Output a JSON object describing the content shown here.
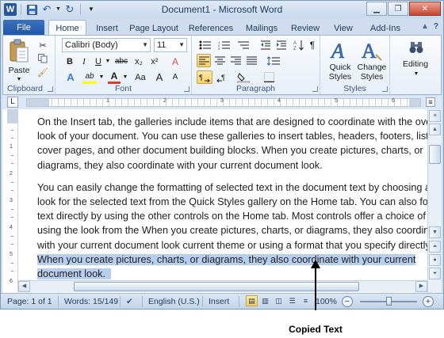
{
  "window": {
    "title": "Document1  -  Microsoft Word"
  },
  "ribbon_tabs": {
    "file": "File",
    "home": "Home",
    "insert": "Insert",
    "page_layout": "Page Layout",
    "references": "References",
    "mailings": "Mailings",
    "review": "Review",
    "view": "View",
    "addins": "Add-Ins"
  },
  "clipboard": {
    "paste_label": "Paste",
    "group_label": "Clipboard"
  },
  "font": {
    "font_name": "Calibri (Body)",
    "font_size": "11",
    "group_label": "Font",
    "bold": "B",
    "italic": "I",
    "underline": "U",
    "strike": "abc",
    "subscript": "x₂",
    "superscript": "x²",
    "text_effects": "A",
    "highlight": "ab",
    "font_color": "A",
    "change_case": "Aa",
    "grow": "A",
    "shrink": "A",
    "clear": "A"
  },
  "paragraph": {
    "group_label": "Paragraph"
  },
  "styles": {
    "quick_styles_line1": "Quick",
    "quick_styles_line2": "Styles",
    "change_styles_line1": "Change",
    "change_styles_line2": "Styles",
    "group_label": "Styles"
  },
  "editing": {
    "label": "Editing"
  },
  "document": {
    "paragraph1": [
      "On the Insert tab, the galleries include items that are designed to coordinate with the overall",
      "look of your document. You can use these galleries to insert tables, headers, footers, lists,",
      "cover pages, and other document building blocks. When you create pictures, charts, or",
      "diagrams, they also coordinate with your current document look."
    ],
    "paragraph2": [
      "You can easily change the formatting of selected text in the document text by choosing a",
      "look for the selected text from the Quick Styles gallery  on the Home tab. You can also format",
      "text directly by using the other controls on the Home tab. Most controls offer a choice of",
      "using the look from the When you create pictures, charts, or diagrams, they also coordinate",
      "with your current document look current theme or using a  format that you specify directly."
    ],
    "selected_lines": [
      "When you create pictures, charts, or diagrams, they also coordinate with your current",
      "document look."
    ]
  },
  "statusbar": {
    "page": "Page: 1 of 1",
    "words": "Words: 15/149",
    "language": "English (U.S.)",
    "mode": "Insert",
    "zoom": "100%",
    "zoom_minus": "−",
    "zoom_plus": "+"
  },
  "ruler": {
    "numbers": [
      "1",
      "2",
      "3",
      "4",
      "5",
      "6"
    ],
    "vertical_numbers": [
      "1",
      "2",
      "3",
      "4",
      "5",
      "6"
    ]
  },
  "annotation": {
    "label": "Copied Text"
  },
  "icons": {
    "word": "word-app-icon",
    "save": "save-icon",
    "undo": "undo-icon",
    "redo": "redo-icon",
    "customize": "customize-qat-icon"
  },
  "colors": {
    "selection_highlight": "#b7cfef",
    "file_tab": "#2b579a",
    "highlight_color": "#ffff00",
    "font_color_red": "#e03a2f"
  }
}
